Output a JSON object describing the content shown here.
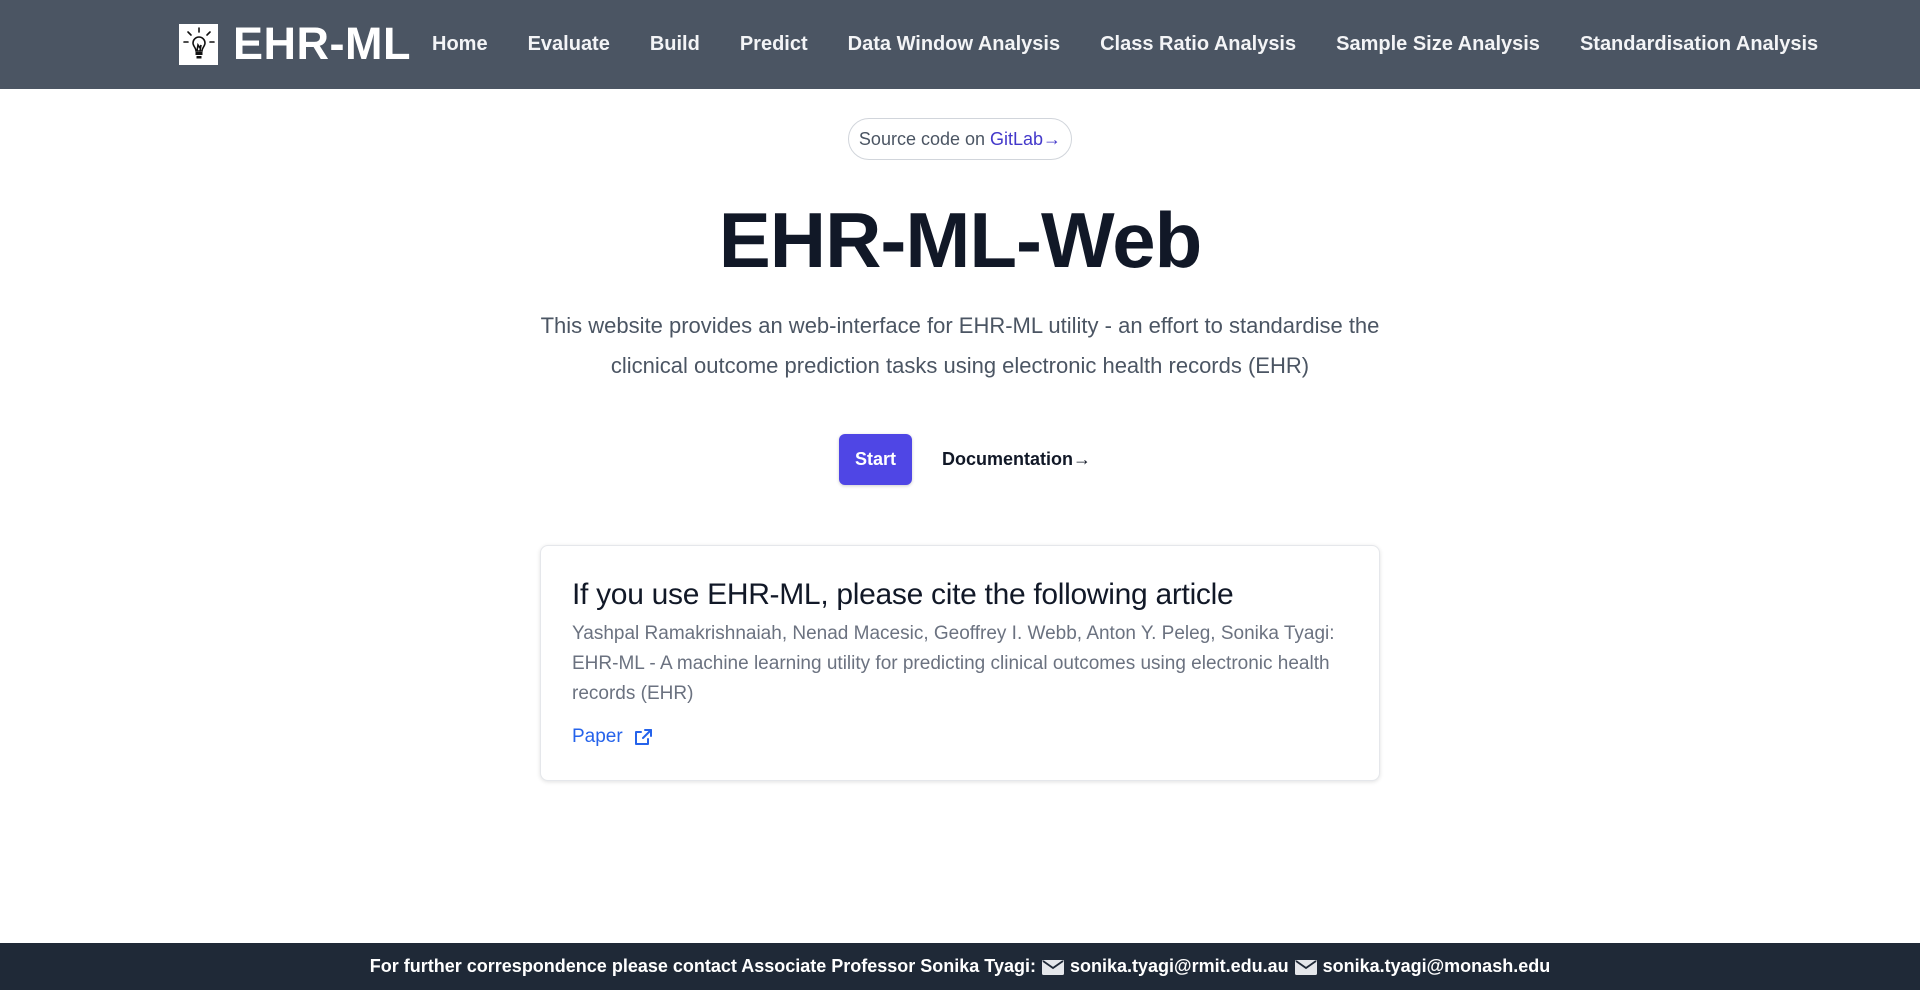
{
  "nav": {
    "brand": "EHR-ML",
    "links": [
      "Home",
      "Evaluate",
      "Build",
      "Predict",
      "Data Window Analysis",
      "Class Ratio Analysis",
      "Sample Size Analysis",
      "Standardisation Analysis"
    ]
  },
  "source": {
    "prefix": "Source code on",
    "link_label": "GitLab→"
  },
  "hero": {
    "title": "EHR-ML-Web",
    "description": "This website provides an web-interface for EHR-ML utility - an effort to standardise the clicnical outcome prediction tasks using electronic health records (EHR)",
    "start_label": "Start",
    "docs_label": "Documentation→"
  },
  "citation": {
    "heading": "If you use EHR-ML, please cite the following article",
    "authors": "Yashpal Ramakrishnaiah, Nenad Macesic, Geoffrey I. Webb, Anton Y. Peleg, Sonika Tyagi: EHR-ML - A machine learning utility for predicting clinical outcomes using electronic health records (EHR)",
    "paper_label": "Paper"
  },
  "footer": {
    "text": "For further correspondence please contact Associate Professor Sonika Tyagi:",
    "email1": "sonika.tyagi@rmit.edu.au",
    "email2": "sonika.tyagi@monash.edu"
  },
  "colors": {
    "navbar": "#4b5563",
    "accent": "#4f46e5",
    "link": "#2563eb",
    "footer": "#1f2937"
  }
}
